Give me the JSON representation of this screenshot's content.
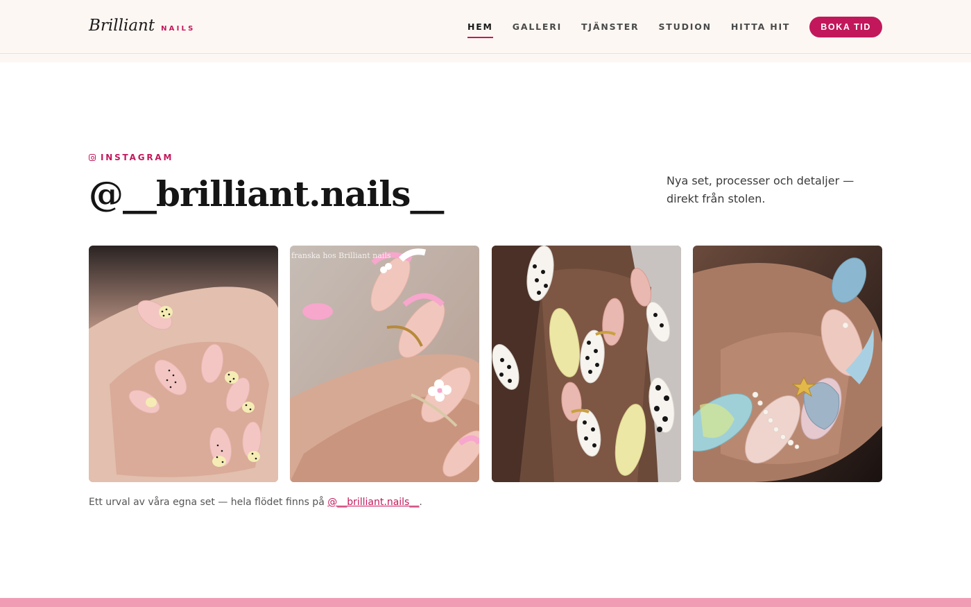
{
  "header": {
    "logo_main": "Brilliant",
    "logo_sub": "NAILS",
    "nav": [
      {
        "label": "HEM",
        "active": true
      },
      {
        "label": "GALLERI",
        "active": false
      },
      {
        "label": "TJÄNSTER",
        "active": false
      },
      {
        "label": "STUDION",
        "active": false
      },
      {
        "label": "HITTA HIT",
        "active": false
      }
    ],
    "cta_label": "BOKA TID"
  },
  "instagram": {
    "icon": "instagram-icon",
    "eyebrow": "INSTAGRAM",
    "handle": "@__brilliant.nails__",
    "tagline": "Nya set, processer och detaljer — direkt från stolen.",
    "caption_prefix": "Ett urval av våra egna set — hela flödet finns på ",
    "caption_link": "@__brilliant.nails__",
    "caption_suffix": ".",
    "posts": [
      {
        "image": "yellow-polka-dot-french-nails-photo",
        "overlay_text": ""
      },
      {
        "image": "pink-french-flower-nails-photo",
        "overlay_text": "franska hos Brilliant nails"
      },
      {
        "image": "black-white-dot-yellow-nails-photo",
        "overlay_text": ""
      },
      {
        "image": "seashell-pearl-nails-photo",
        "overlay_text": ""
      }
    ]
  },
  "colors": {
    "accent": "#c2185b",
    "header_bg": "#fdf7f3",
    "footer_strip": "#f19cb5"
  }
}
